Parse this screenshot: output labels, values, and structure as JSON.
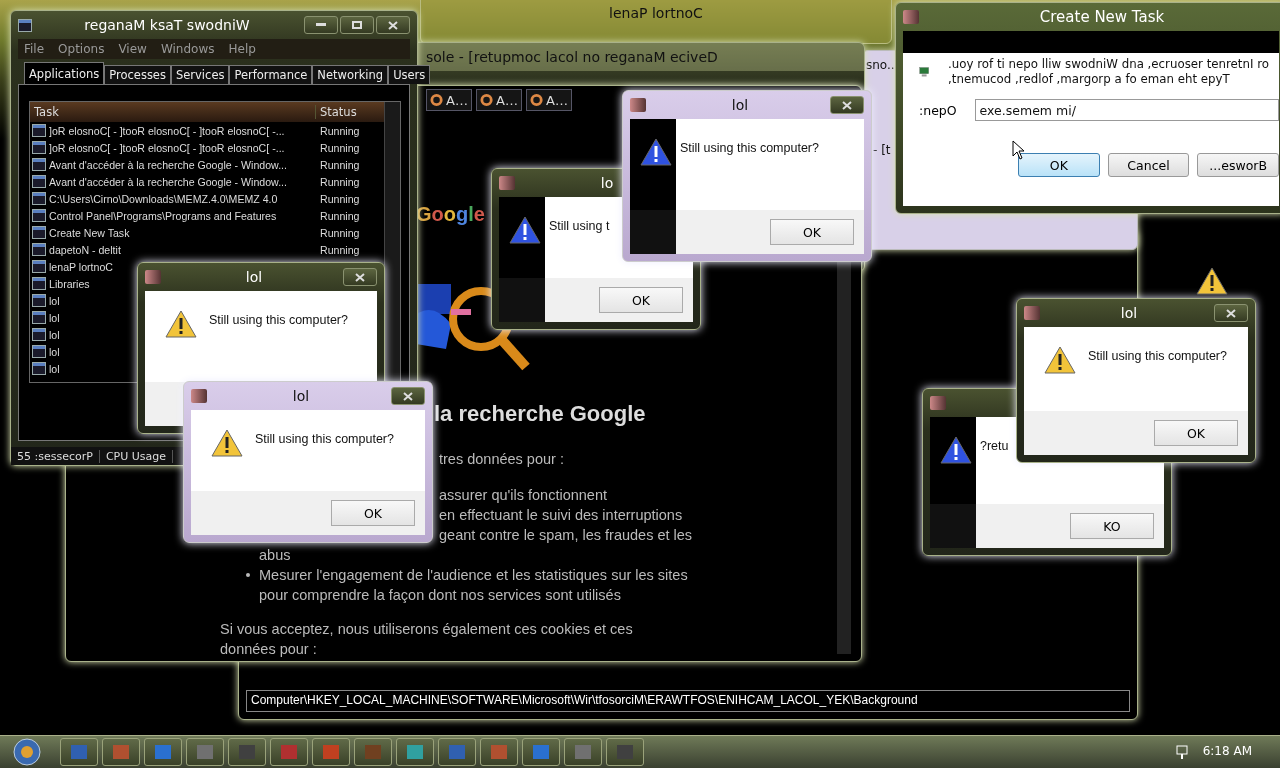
{
  "control_panel": {
    "title": "lenaP lortnoC"
  },
  "device_manager": {
    "title": "sole - [retupmoc lacol no reganaM eciveD"
  },
  "side_window": {
    "title": "sno..",
    "line": "- [t"
  },
  "registry_editor": {
    "path": "Computer\\HKEY_LOCAL_MACHINE\\SOFTWARE\\Microsoft\\Wir\\tfosorciM\\ERAWTFOS\\ENIHCAM_LACOL_YEK\\Background"
  },
  "browser": {
    "tabs": [
      {
        "label": "A…",
        "selected": false
      },
      {
        "label": "A…",
        "selected": false
      },
      {
        "label": "A…",
        "selected": false
      }
    ],
    "logo": "Google",
    "content": [
      {
        "kind": "heading",
        "text": "la recherche Google"
      },
      {
        "kind": "lead",
        "text": "tres données pour :"
      },
      {
        "kind": "lead",
        "text": "assurer qu'ils fonctionnent"
      },
      {
        "kind": "fragment",
        "text": "en effectuant le suivi des interruptions"
      },
      {
        "kind": "fragment",
        "text": "geant contre le spam, les fraudes et les"
      },
      {
        "kind": "continuation",
        "text": "abus"
      },
      {
        "kind": "bullet",
        "text": "Mesurer l'engagement de l'audience et les statistiques sur les sites pour comprendre la façon dont nos services sont utilisés"
      },
      {
        "kind": "paragraph",
        "text": "Si vous acceptez, nous utiliserons également ces cookies et ces"
      },
      {
        "kind": "text",
        "text": "données pour :"
      }
    ]
  },
  "task_manager": {
    "title": "reganaM ksaT swodniW",
    "menu": [
      "File",
      "Options",
      "View",
      "Windows",
      "Help"
    ],
    "tabs": [
      {
        "label": "Applications",
        "selected": true
      },
      {
        "label": "Processes",
        "selected": false
      },
      {
        "label": "Services",
        "selected": false
      },
      {
        "label": "Performance",
        "selected": false
      },
      {
        "label": "Networking",
        "selected": false
      },
      {
        "label": "Users",
        "selected": false
      }
    ],
    "columns": [
      "Task",
      "Status"
    ],
    "rows": [
      {
        "task": "]oR elosnoC[ - ]tooR elosnoC[ - ]tooR elosnoC[ -...",
        "status": "Running"
      },
      {
        "task": "]oR elosnoC[ - ]tooR elosnoC[ - ]tooR elosnoC[ -...",
        "status": "Running"
      },
      {
        "task": "Avant d'accéder à la recherche Google - Window...",
        "status": "Running"
      },
      {
        "task": "Avant d'accéder à la recherche Google - Window...",
        "status": "Running"
      },
      {
        "task": "C:\\Users\\Cirno\\Downloads\\MEMZ.4.0\\MEMZ 4.0",
        "status": "Running"
      },
      {
        "task": "Control Panel\\Programs\\Programs and Features",
        "status": "Running"
      },
      {
        "task": "Create New Task",
        "status": "Running"
      },
      {
        "task": "dapetoN - deltit",
        "status": "Running"
      },
      {
        "task": "lenaP lortnoC"
      },
      {
        "task": "Libraries"
      },
      {
        "task": "lol"
      },
      {
        "task": "lol"
      },
      {
        "task": "lol"
      },
      {
        "task": "lol"
      },
      {
        "task": "lol"
      }
    ],
    "status_bar": [
      "55 :sessecorP",
      "CPU Usage"
    ]
  },
  "dialogs": [
    {
      "title": "lol",
      "message": "Still using this computer?"
    },
    {
      "title": "lol",
      "message": "Still using this computer?",
      "button": "OK"
    },
    {
      "title": "lo",
      "message": "Still using t",
      "button": "OK"
    },
    {
      "title": "lol",
      "message": "Still using this computer?",
      "button": "OK"
    },
    {
      "message": "?retu",
      "button": "KO"
    },
    {
      "title": "lol",
      "message": "Still using this computer?",
      "button": "OK"
    }
  ],
  "create_task": {
    "title": "Create New Task",
    "description": [
      ".uoy rof ti nepo lliw swodniW dna ,ecruoser tenretnI ro",
      ",tnemucod ,redlof ,margorp a fo eman eht epyT"
    ],
    "label": ":nepO",
    "value": "exe.semem mi/",
    "buttons": [
      {
        "label": "OK",
        "default": true
      },
      {
        "label": "Cancel",
        "default": false
      },
      {
        "label": "...esworB",
        "default": false
      }
    ]
  },
  "taskbar": {
    "clock": "6:18 AM"
  }
}
